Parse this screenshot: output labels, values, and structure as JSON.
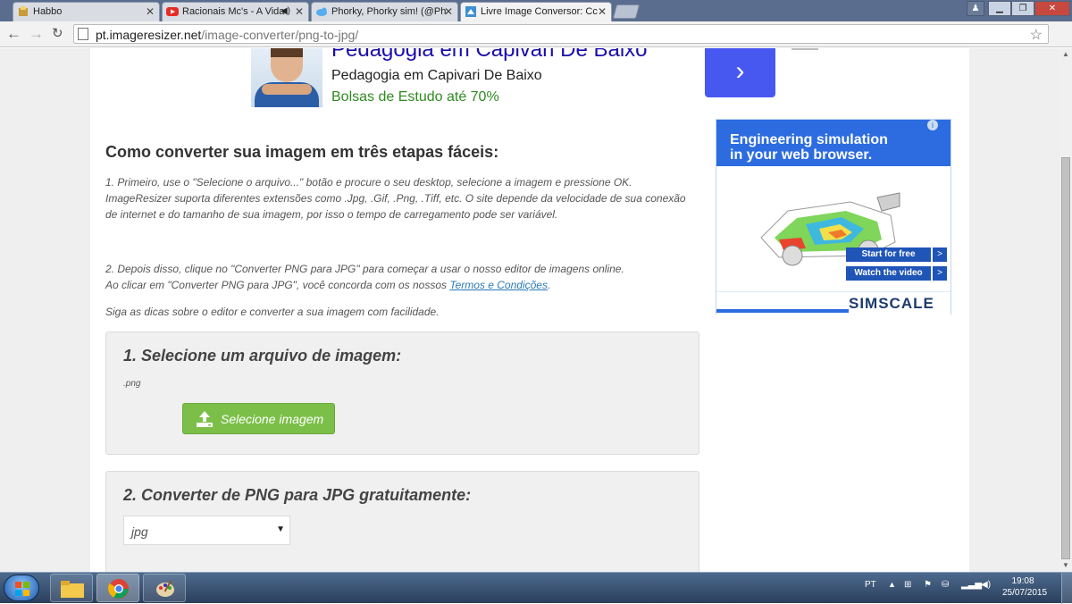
{
  "browser": {
    "tabs": [
      {
        "title": "Habbo",
        "favicon": "habbo-icon"
      },
      {
        "title": "Racionais Mc's - A Vida",
        "favicon": "youtube-icon",
        "audio": true
      },
      {
        "title": "Phorky, Phorky sim! (@Ph",
        "favicon": "twitter-icon"
      },
      {
        "title": "Livre Image Conversor: Cc",
        "favicon": "imageresizer-icon",
        "active": true
      }
    ],
    "url_domain": "pt.imageresizer.net",
    "url_path": "/image-converter/png-to-jpg/"
  },
  "top_ad": {
    "headline": "Pedagogia em Capivari De Baixo",
    "title": "Pedagogia em Capivari De Baixo",
    "subtitle": "Bolsas de Estudo até 70%",
    "arrow": "›"
  },
  "content": {
    "heading": "Como converter sua imagem em três etapas fáceis:",
    "para1": "1. Primeiro, use o \"Selecione o arquivo...\" botão e procure o seu desktop, selecione a imagem e pressione OK. ImageResizer suporta diferentes extensões como .Jpg, .Gif, .Png, .Tiff, etc. O site depende da velocidade de sua conexão de internet e do tamanho de sua imagem, por isso o tempo de carregamento pode ser variável.",
    "para2_line1": "2. Depois disso, clique no \"Converter PNG para JPG\" para começar a usar o nosso editor de imagens online.",
    "para2_line2": "Ao clicar em \"Converter PNG para JPG\", você concorda com os nossos",
    "terms_link": "Termos e Condições",
    "para2_end": ".",
    "para3": "Siga as dicas sobre o editor e converter a sua imagem com facilidade."
  },
  "step1": {
    "title": "1. Selecione um arquivo de imagem:",
    "extension": ".png",
    "button": "Selecione imagem"
  },
  "step2": {
    "title": "2. Converter de PNG para JPG gratuitamente:",
    "format_value": "jpg"
  },
  "side_ad": {
    "headline_line1": "Engineering simulation",
    "headline_line2": "in your web browser.",
    "cta1": "Start for free",
    "cta2": "Watch the video",
    "cta_arrow": ">",
    "brand": "SIMSCALE"
  },
  "taskbar": {
    "lang": "PT",
    "time": "19:08",
    "date": "25/07/2015"
  },
  "colors": {
    "upload_button": "#7bbf48",
    "ad_blue": "#2c6ce0",
    "ad_arrow": "#4758f0",
    "link": "#2a7ab8"
  }
}
